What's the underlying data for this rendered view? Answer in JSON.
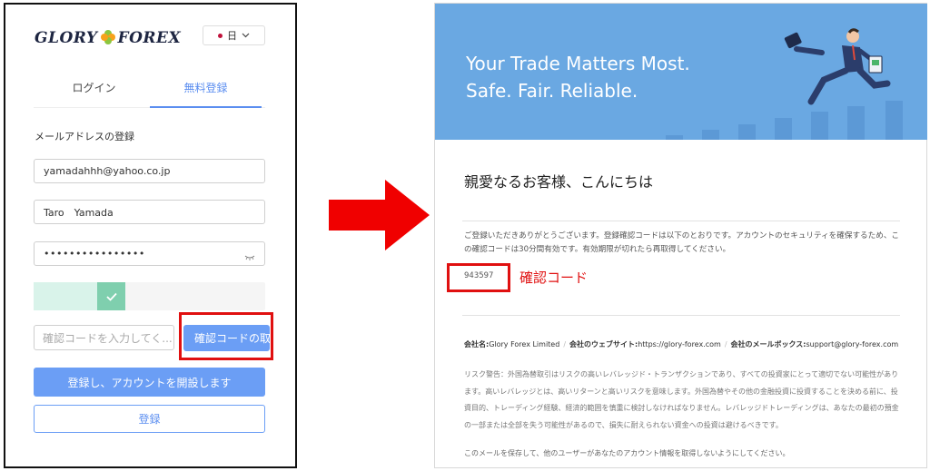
{
  "left": {
    "logo": {
      "part1": "GLORY",
      "part2": "FOREX"
    },
    "language": "日",
    "tabs": {
      "login": "ログイン",
      "register": "無料登録"
    },
    "section_title": "メールアドレスの登録",
    "email": "yamadahhh@yahoo.co.jp",
    "name": "Taro　Yamada",
    "password_mask": "••••••••••••••••",
    "code_placeholder": "確認コードを入力してく...",
    "get_code_button": "確認コードの取",
    "submit_button": "登録し、アカウントを開設します",
    "register_button": "登録"
  },
  "email": {
    "banner_line1": "Your Trade Matters Most.",
    "banner_line2": "Safe. Fair. Reliable.",
    "greeting": "親愛なるお客様、こんにちは",
    "body": "ご登録いただきありがとうございます。登録確認コードは以下のとおりです。アカウントのセキュリティを確保するため、この確認コードは30分間有効です。有効期限が切れたら再取得してください。",
    "code": "943597",
    "code_label": "確認コード",
    "company_label": "会社名:",
    "company_value": "Glory Forex Limited",
    "website_label": "会社のウェブサイト:",
    "website_value": "https://glory-forex.com",
    "mailbox_label": "会社のメールボックス:",
    "mailbox_value": "support@glory-forex.com",
    "risk_warning": "リスク警告：外国為替取引はリスクの高いレバレッジド・トランザクションであり、すべての投資家にとって適切でない可能性があります。高いレバレッジとは、高いリターンと高いリスクを意味します。外国為替やその他の金融投資に投資することを決める前に、投資目的、トレーディング経験、経済的範囲を慎重に検討しなければなりません。レバレッジドトレーディングは、あなたの最初の預金の一部または全部を失う可能性があるので、損失に耐えられない資金への投資は避けるべきです。",
    "footer": "このメールを保存して、他のユーザーがあなたのアカウント情報を取得しないようにしてください。"
  },
  "colors": {
    "accent": "#6b9ef5",
    "highlight": "#e01010",
    "banner": "#6aa8e2",
    "slider": "#7fcfae"
  }
}
